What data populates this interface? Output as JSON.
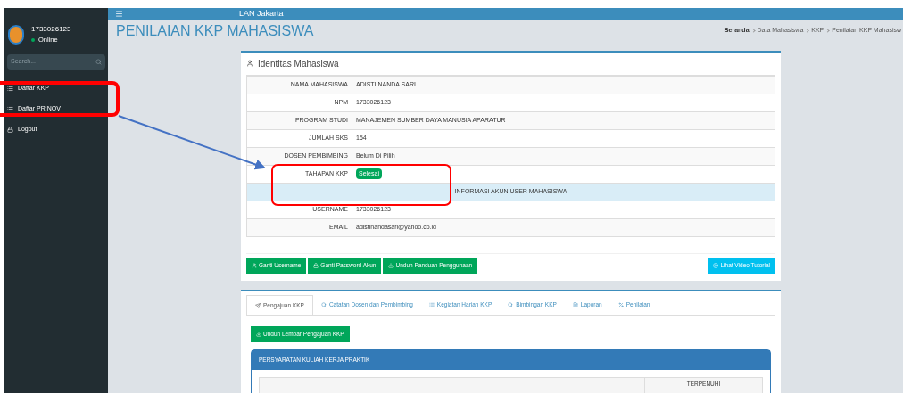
{
  "header": {
    "title": "LAN Jakarta"
  },
  "sidebar": {
    "user": "1733026123",
    "status": "Online",
    "search_placeholder": "Search...",
    "items": [
      {
        "label": "Daftar KKP"
      },
      {
        "label": "Daftar PRINOV"
      },
      {
        "label": "Logout"
      }
    ]
  },
  "page_title": "PENILAIAN KKP MAHASISWA",
  "breadcrumb": [
    "Beranda",
    "Data Mahasiswa",
    "KKP",
    "Penilaian KKP Mahasisw"
  ],
  "identity": {
    "title": "Identitas Mahasiswa",
    "rows": [
      {
        "kind": "field",
        "label": "NAMA MAHASISWA",
        "value": "ADISTI NANDA SARI"
      },
      {
        "kind": "field",
        "label": "NPM",
        "value": "1733026123"
      },
      {
        "kind": "field",
        "label": "PROGRAM STUDI",
        "value": "MANAJEMEN SUMBER DAYA MANUSIA APARATUR"
      },
      {
        "kind": "field",
        "label": "JUMLAH SKS",
        "value": "154"
      },
      {
        "kind": "field",
        "label": "DOSEN PEMBIMBING",
        "value": "Belum Di Pilih"
      },
      {
        "kind": "badge",
        "label": "TAHAPAN KKP",
        "value": "Selesai"
      },
      {
        "kind": "section",
        "label": "INFORMASI AKUN USER MAHASISWA"
      },
      {
        "kind": "field",
        "label": "USERNAME",
        "value": "1733026123"
      },
      {
        "kind": "field",
        "label": "EMAIL",
        "value": "adistinandasari@yahoo.co.id"
      }
    ],
    "buttons": [
      {
        "label": "Ganti Username"
      },
      {
        "label": "Ganti Password Akun"
      },
      {
        "label": "Unduh Panduan Penggunaan"
      }
    ],
    "video_button": "Lihat Video Tutorial"
  },
  "tabs": [
    {
      "label": "Pengajuan KKP",
      "selected": true
    },
    {
      "label": "Catatan Dosen dan Pembimbing",
      "selected": false
    },
    {
      "label": "Kegiatan Harian KKP",
      "selected": false
    },
    {
      "label": "Bimbingan KKP",
      "selected": false
    },
    {
      "label": "Laporan",
      "selected": false
    },
    {
      "label": "Penilaian",
      "selected": false
    }
  ],
  "download_button": "Unduh Lembar Pengajuan KKP",
  "requirements": {
    "title": "PERSYARATAN KULIAH KERJA PRAKTIK",
    "columns": [
      "TERPENUHI"
    ]
  }
}
